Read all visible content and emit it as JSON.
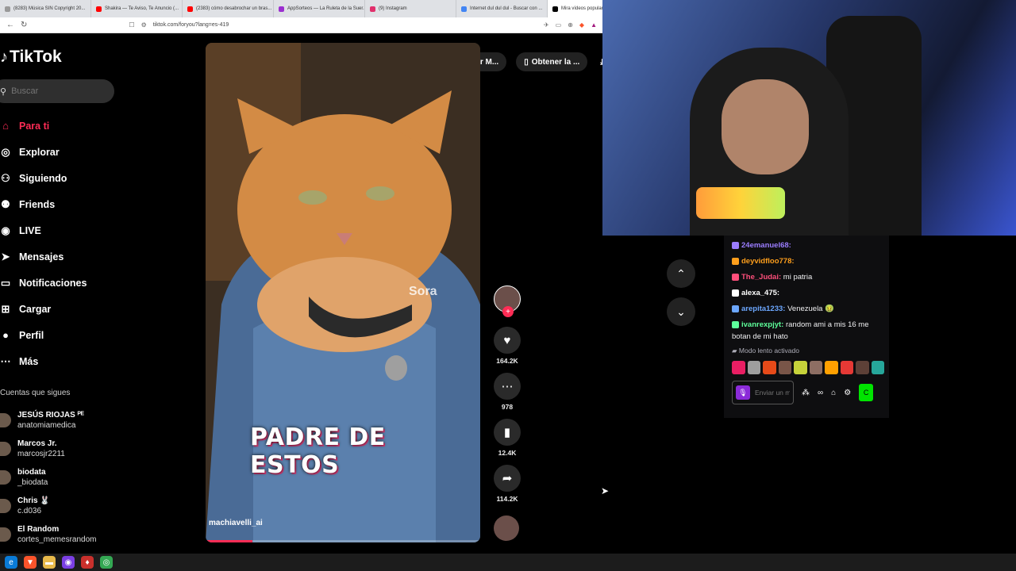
{
  "browser": {
    "tabs": [
      {
        "label": "(8283) Música SIN Copyright 20...",
        "color": "#999999"
      },
      {
        "label": "Shakira — Te Aviso, Te Anuncio (...",
        "color": "#ff0000"
      },
      {
        "label": "(2383) cómo desabrochar un bras...",
        "color": "#ff0000"
      },
      {
        "label": "AppSorteos — La Ruleta de la Suer...",
        "color": "#9b2fd0"
      },
      {
        "label": "(9) Instagram",
        "color": "#e1306c"
      },
      {
        "label": "Internet dul dul dul - Buscar con ...",
        "color": "#4285f4"
      },
      {
        "label": "Mira vídeos populares ...",
        "color": "#000000"
      }
    ],
    "url": "tiktok.com/foryou?lang=es-419"
  },
  "tiktok": {
    "logo": "TikTok",
    "search_placeholder": "Buscar",
    "menu": [
      {
        "label": "Para ti",
        "icon": "home-icon",
        "glyph": "⌂"
      },
      {
        "label": "Explorar",
        "icon": "compass-icon",
        "glyph": "◎"
      },
      {
        "label": "Siguiendo",
        "icon": "following-icon",
        "glyph": "⚇"
      },
      {
        "label": "Friends",
        "icon": "friends-icon",
        "glyph": "⚉"
      },
      {
        "label": "LIVE",
        "icon": "live-icon",
        "glyph": "◉"
      },
      {
        "label": "Mensajes",
        "icon": "messages-icon",
        "glyph": "➤"
      },
      {
        "label": "Notificaciones",
        "icon": "inbox-icon",
        "glyph": "▭"
      },
      {
        "label": "Cargar",
        "icon": "upload-icon",
        "glyph": "⊞"
      },
      {
        "label": "Perfil",
        "icon": "profile-icon",
        "glyph": "●"
      },
      {
        "label": "Más",
        "icon": "more-icon",
        "glyph": "⋯"
      }
    ],
    "following_title": "Cuentas que sigues",
    "following": [
      {
        "name": "JESÚS RIOJAS ᴾᴱ",
        "handle": "anatomiamedica"
      },
      {
        "name": "Marcos Jr.",
        "handle": "marcosjr2211"
      },
      {
        "name": "biodata",
        "handle": "_biodata"
      },
      {
        "name": "Chris 🐰",
        "handle": "c.d036"
      },
      {
        "name": "El Random",
        "handle": "cortes_memesrandom"
      }
    ],
    "top_actions": [
      "Obtener M...",
      "Obtener la ...",
      "A"
    ],
    "video": {
      "caption": "PADRE DE ESTOS",
      "author": "machiavelli_ai",
      "watermark": "Sora",
      "progress": 0.17
    },
    "stats": {
      "likes": "164.2K",
      "comments": "978",
      "saves": "12.4K",
      "shares": "114.2K"
    }
  },
  "chat": {
    "messages": [
      {
        "user": "24emanuel68:",
        "text": "",
        "color": "#9b7dff"
      },
      {
        "user": "deyvidfloo778:",
        "text": "",
        "color": "#ff9f1c"
      },
      {
        "user": "The_Judai:",
        "text": " mi patria",
        "color": "#ff4f7b"
      },
      {
        "user": "alexa_475:",
        "text": "",
        "color": "#ffffff"
      },
      {
        "user": "arepita1233:",
        "text": " Venezuela 🤢",
        "color": "#6ca7ff"
      },
      {
        "user": "ivanrexpjyt:",
        "text": " random ami a mis 16 me botan de mi hato",
        "color": "#5eff9b"
      }
    ],
    "slow_mode": "Modo lento activado",
    "input_placeholder": "Enviar un mensaje",
    "send_label": "C"
  },
  "colors": {
    "accent": "#fe2c55",
    "chat_bg": "#0e0e10"
  }
}
